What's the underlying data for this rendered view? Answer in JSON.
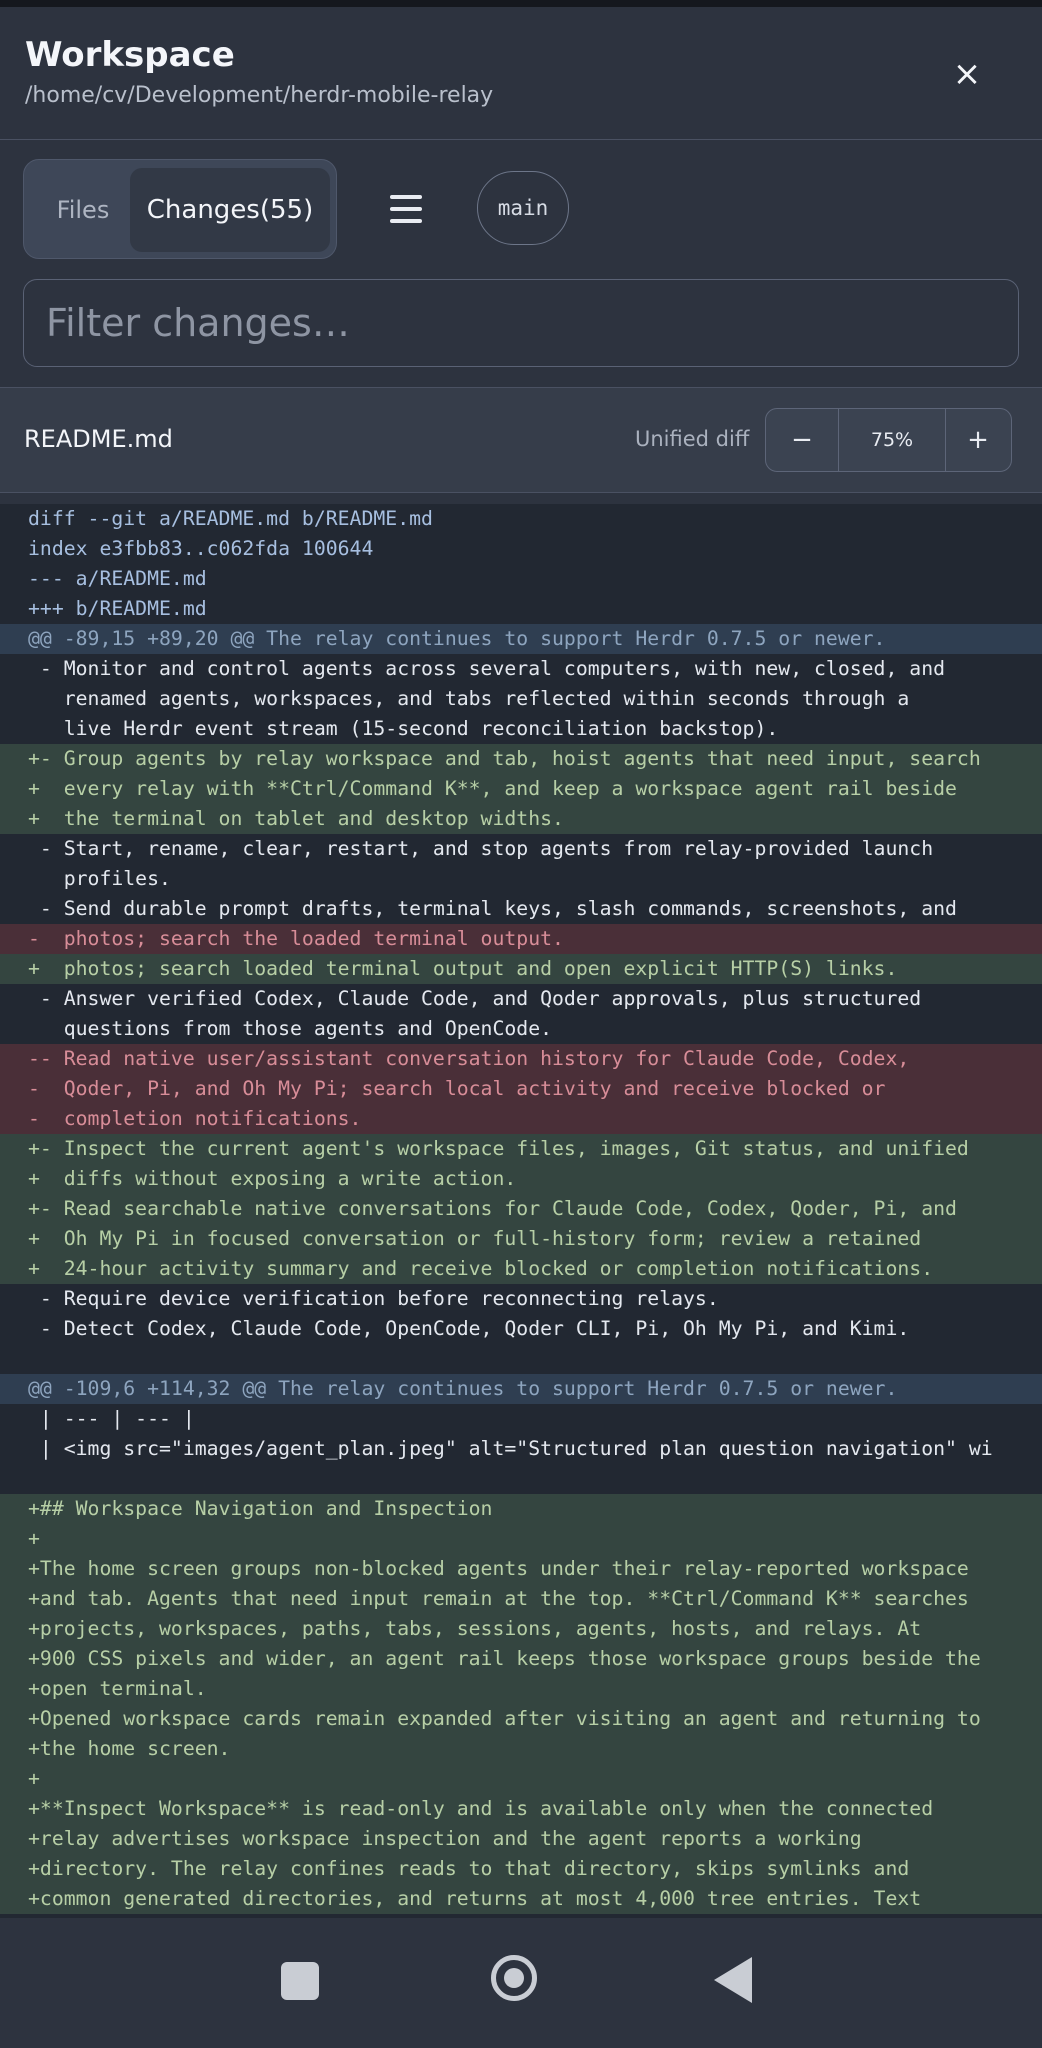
{
  "header": {
    "title": "Workspace",
    "path": "/home/cv/Development/herdr-mobile-relay",
    "close_label": "×"
  },
  "tabs": {
    "files_label": "Files",
    "changes_label": "Changes(55)"
  },
  "branch": "main",
  "filter": {
    "placeholder": "Filter changes…",
    "value": ""
  },
  "file": {
    "name": "README.md",
    "view_mode": "Unified diff",
    "zoom_minus": "−",
    "zoom_value": "75%",
    "zoom_plus": "+"
  },
  "diff_lines": [
    {
      "type": "head",
      "text": "diff --git a/README.md b/README.md"
    },
    {
      "type": "head",
      "text": "index e3fbb83..c062fda 100644"
    },
    {
      "type": "head",
      "text": "--- a/README.md"
    },
    {
      "type": "head",
      "text": "+++ b/README.md"
    },
    {
      "type": "hunk",
      "text": "@@ -89,15 +89,20 @@ The relay continues to support Herdr 0.7.5 or newer."
    },
    {
      "type": "ctx",
      "text": " - Monitor and control agents across several computers, with new, closed, and"
    },
    {
      "type": "ctx",
      "text": "   renamed agents, workspaces, and tabs reflected within seconds through a"
    },
    {
      "type": "ctx",
      "text": "   live Herdr event stream (15-second reconciliation backstop)."
    },
    {
      "type": "add",
      "text": "+- Group agents by relay workspace and tab, hoist agents that need input, search"
    },
    {
      "type": "add",
      "text": "+  every relay with **Ctrl/Command K**, and keep a workspace agent rail beside"
    },
    {
      "type": "add",
      "text": "+  the terminal on tablet and desktop widths."
    },
    {
      "type": "ctx",
      "text": " - Start, rename, clear, restart, and stop agents from relay-provided launch"
    },
    {
      "type": "ctx",
      "text": "   profiles."
    },
    {
      "type": "ctx",
      "text": " - Send durable prompt drafts, terminal keys, slash commands, screenshots, and"
    },
    {
      "type": "del",
      "text": "-  photos; search the loaded terminal output."
    },
    {
      "type": "add",
      "text": "+  photos; search loaded terminal output and open explicit HTTP(S) links."
    },
    {
      "type": "ctx",
      "text": " - Answer verified Codex, Claude Code, and Qoder approvals, plus structured"
    },
    {
      "type": "ctx",
      "text": "   questions from those agents and OpenCode."
    },
    {
      "type": "del",
      "text": "-- Read native user/assistant conversation history for Claude Code, Codex,"
    },
    {
      "type": "del",
      "text": "-  Qoder, Pi, and Oh My Pi; search local activity and receive blocked or"
    },
    {
      "type": "del",
      "text": "-  completion notifications."
    },
    {
      "type": "add",
      "text": "+- Inspect the current agent's workspace files, images, Git status, and unified"
    },
    {
      "type": "add",
      "text": "+  diffs without exposing a write action."
    },
    {
      "type": "add",
      "text": "+- Read searchable native conversations for Claude Code, Codex, Qoder, Pi, and"
    },
    {
      "type": "add",
      "text": "+  Oh My Pi in focused conversation or full-history form; review a retained"
    },
    {
      "type": "add",
      "text": "+  24-hour activity summary and receive blocked or completion notifications."
    },
    {
      "type": "ctx",
      "text": " - Require device verification before reconnecting relays."
    },
    {
      "type": "ctx",
      "text": " - Detect Codex, Claude Code, OpenCode, Qoder CLI, Pi, Oh My Pi, and Kimi."
    },
    {
      "type": "blank",
      "text": " "
    },
    {
      "type": "hunk",
      "text": "@@ -109,6 +114,32 @@ The relay continues to support Herdr 0.7.5 or newer."
    },
    {
      "type": "ctx",
      "text": " | --- | --- |"
    },
    {
      "type": "ctx",
      "text": " | <img src=\"images/agent_plan.jpeg\" alt=\"Structured plan question navigation\" wi"
    },
    {
      "type": "blank",
      "text": " "
    },
    {
      "type": "add",
      "text": "+## Workspace Navigation and Inspection"
    },
    {
      "type": "add",
      "text": "+"
    },
    {
      "type": "add",
      "text": "+The home screen groups non-blocked agents under their relay-reported workspace"
    },
    {
      "type": "add",
      "text": "+and tab. Agents that need input remain at the top. **Ctrl/Command K** searches"
    },
    {
      "type": "add",
      "text": "+projects, workspaces, paths, tabs, sessions, agents, hosts, and relays. At"
    },
    {
      "type": "add",
      "text": "+900 CSS pixels and wider, an agent rail keeps those workspace groups beside the"
    },
    {
      "type": "add",
      "text": "+open terminal."
    },
    {
      "type": "add",
      "text": "+Opened workspace cards remain expanded after visiting an agent and returning to"
    },
    {
      "type": "add",
      "text": "+the home screen."
    },
    {
      "type": "add",
      "text": "+"
    },
    {
      "type": "add",
      "text": "+**Inspect Workspace** is read-only and is available only when the connected"
    },
    {
      "type": "add",
      "text": "+relay advertises workspace inspection and the agent reports a working"
    },
    {
      "type": "add",
      "text": "+directory. The relay confines reads to that directory, skips symlinks and"
    },
    {
      "type": "add",
      "text": "+common generated directories, and returns at most 4,000 tree entries. Text"
    }
  ],
  "icons": {
    "close": "close-icon",
    "menu": "hamburger-menu-icon",
    "nav_recents": "square-recents-icon",
    "nav_home": "circle-home-icon",
    "nav_back": "triangle-back-icon"
  },
  "colors": {
    "background": "#2d333f",
    "diff_background": "#222832",
    "added_line": "#344540",
    "removed_line": "#4a2f38",
    "hunk_line": "#2f3e51"
  }
}
